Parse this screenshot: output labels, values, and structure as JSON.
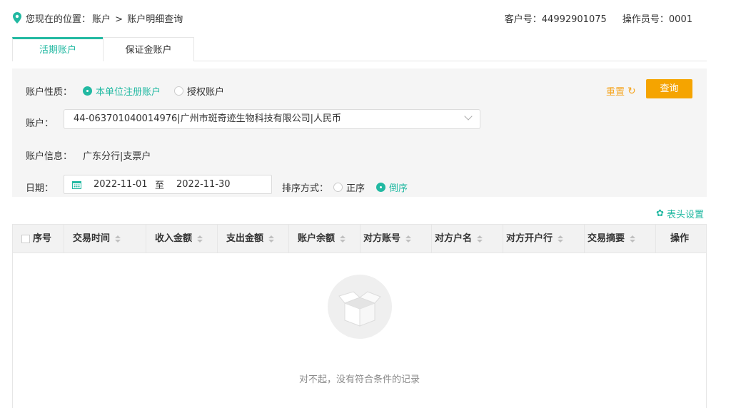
{
  "breadcrumb": {
    "prefix": "您现在的位置：",
    "level1": "账户",
    "separator": ">",
    "level2": "账户明细查询"
  },
  "user_info": {
    "customer_no": "客户号：44992901075",
    "operator_no": "操作员号：0001"
  },
  "tabs": [
    {
      "label": "活期账户",
      "active": true
    },
    {
      "label": "保证金账户",
      "active": false
    }
  ],
  "filter": {
    "account_type_label": "账户性质：",
    "account_type_options": [
      {
        "label": "本单位注册账户",
        "selected": true
      },
      {
        "label": "授权账户",
        "selected": false
      }
    ],
    "reset_label": "重置",
    "query_label": "查询",
    "account_label": "账户：",
    "account_value": "44-063701040014976|广州市斑奇迹生物科技有限公司|人民币",
    "account_info_label": "账户信息：",
    "account_info_value": "广东分行|支票户",
    "date_label": "日期：",
    "date_start": "2022-11-01",
    "date_to": "至",
    "date_end": "2022-11-30",
    "sort_label": "排序方式：",
    "sort_options": [
      {
        "label": "正序",
        "selected": false
      },
      {
        "label": "倒序",
        "selected": true
      }
    ]
  },
  "column_settings_label": "表头设置",
  "table": {
    "columns": [
      {
        "label": "序号",
        "sortable": false
      },
      {
        "label": "交易时间",
        "sortable": true
      },
      {
        "label": "收入金额",
        "sortable": true
      },
      {
        "label": "支出金额",
        "sortable": true
      },
      {
        "label": "账户余额",
        "sortable": true
      },
      {
        "label": "对方账号",
        "sortable": true
      },
      {
        "label": "对方户名",
        "sortable": true
      },
      {
        "label": "对方开户行",
        "sortable": true
      },
      {
        "label": "交易摘要",
        "sortable": true
      },
      {
        "label": "操作",
        "sortable": false
      }
    ],
    "empty_text": "对不起，没有符合条件的记录"
  },
  "colors": {
    "accent": "#22b9a2",
    "button_orange": "#f5a400",
    "reset_orange": "#f5a623"
  }
}
